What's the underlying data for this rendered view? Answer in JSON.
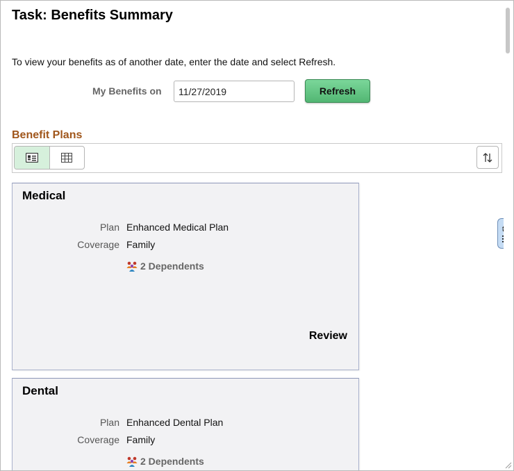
{
  "page": {
    "title": "Task: Benefits Summary",
    "instructions": "To view your benefits as of another date, enter the date and select Refresh.",
    "date_label": "My Benefits on",
    "date_value": "11/27/2019",
    "refresh_label": "Refresh"
  },
  "benefit_plans": {
    "section_title": "Benefit Plans",
    "view_modes": [
      {
        "name": "card-view",
        "icon": "card-view-icon",
        "active": true
      },
      {
        "name": "grid-view",
        "icon": "grid-view-icon",
        "active": false
      }
    ],
    "sort_icon": "sort-icon",
    "cards": [
      {
        "title": "Medical",
        "plan_label": "Plan",
        "plan_value": "Enhanced Medical Plan",
        "coverage_label": "Coverage",
        "coverage_value": "Family",
        "dependents": "2 Dependents",
        "action": "Review"
      },
      {
        "title": "Dental",
        "plan_label": "Plan",
        "plan_value": "Enhanced Dental Plan",
        "coverage_label": "Coverage",
        "coverage_value": "Family",
        "dependents": "2 Dependents"
      }
    ]
  },
  "colors": {
    "section_title": "#a0561b",
    "refresh_button": "#5cbf7c",
    "active_view": "#d6f0dc",
    "side_tab": "#c5dcf4"
  }
}
